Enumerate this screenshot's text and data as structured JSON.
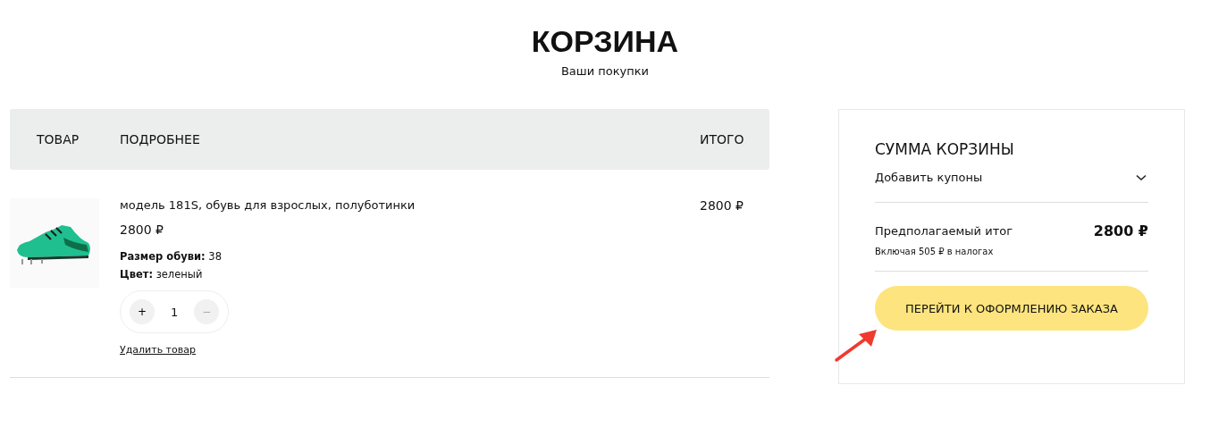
{
  "page": {
    "title": "КОРЗИНА",
    "subtitle": "Ваши покупки"
  },
  "table": {
    "columns": [
      "ТОВАР",
      "ПОДРОБНЕЕ",
      "ИТОГО"
    ],
    "rows": [
      {
        "image": {
          "kind": "picture"
        },
        "name": "модель 181S, обувь для взрослых, полуботинки",
        "price": "2800 ₽",
        "attributes": [
          "**Размер обуви:** 38",
          "**Цвет:** зеленый"
        ],
        "quantity": {
          "increase": "+",
          "value": "1",
          "decrease": "−"
        },
        "remove": "Удалить товар",
        "total": "2800 ₽"
      }
    ]
  },
  "summary": {
    "title": "СУММА КОРЗИНЫ",
    "coupons": {
      "label": "Добавить купоны",
      "expanded": false
    },
    "estimate_label": "Предполагаемый итог",
    "estimate_value": "2800 ₽",
    "tax_note": "Включая 505 ₽ в налогах",
    "checkout": "ПЕРЕЙТИ К ОФОРМЛЕНИЮ ЗАКАЗА"
  }
}
